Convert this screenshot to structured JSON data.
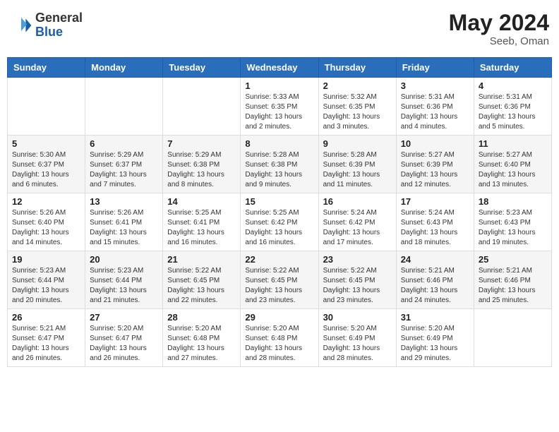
{
  "header": {
    "logo_line1": "General",
    "logo_line2": "Blue",
    "month_year": "May 2024",
    "location": "Seeb, Oman"
  },
  "days_of_week": [
    "Sunday",
    "Monday",
    "Tuesday",
    "Wednesday",
    "Thursday",
    "Friday",
    "Saturday"
  ],
  "weeks": [
    [
      {
        "day": "",
        "info": ""
      },
      {
        "day": "",
        "info": ""
      },
      {
        "day": "",
        "info": ""
      },
      {
        "day": "1",
        "info": "Sunrise: 5:33 AM\nSunset: 6:35 PM\nDaylight: 13 hours\nand 2 minutes."
      },
      {
        "day": "2",
        "info": "Sunrise: 5:32 AM\nSunset: 6:35 PM\nDaylight: 13 hours\nand 3 minutes."
      },
      {
        "day": "3",
        "info": "Sunrise: 5:31 AM\nSunset: 6:36 PM\nDaylight: 13 hours\nand 4 minutes."
      },
      {
        "day": "4",
        "info": "Sunrise: 5:31 AM\nSunset: 6:36 PM\nDaylight: 13 hours\nand 5 minutes."
      }
    ],
    [
      {
        "day": "5",
        "info": "Sunrise: 5:30 AM\nSunset: 6:37 PM\nDaylight: 13 hours\nand 6 minutes."
      },
      {
        "day": "6",
        "info": "Sunrise: 5:29 AM\nSunset: 6:37 PM\nDaylight: 13 hours\nand 7 minutes."
      },
      {
        "day": "7",
        "info": "Sunrise: 5:29 AM\nSunset: 6:38 PM\nDaylight: 13 hours\nand 8 minutes."
      },
      {
        "day": "8",
        "info": "Sunrise: 5:28 AM\nSunset: 6:38 PM\nDaylight: 13 hours\nand 9 minutes."
      },
      {
        "day": "9",
        "info": "Sunrise: 5:28 AM\nSunset: 6:39 PM\nDaylight: 13 hours\nand 11 minutes."
      },
      {
        "day": "10",
        "info": "Sunrise: 5:27 AM\nSunset: 6:39 PM\nDaylight: 13 hours\nand 12 minutes."
      },
      {
        "day": "11",
        "info": "Sunrise: 5:27 AM\nSunset: 6:40 PM\nDaylight: 13 hours\nand 13 minutes."
      }
    ],
    [
      {
        "day": "12",
        "info": "Sunrise: 5:26 AM\nSunset: 6:40 PM\nDaylight: 13 hours\nand 14 minutes."
      },
      {
        "day": "13",
        "info": "Sunrise: 5:26 AM\nSunset: 6:41 PM\nDaylight: 13 hours\nand 15 minutes."
      },
      {
        "day": "14",
        "info": "Sunrise: 5:25 AM\nSunset: 6:41 PM\nDaylight: 13 hours\nand 16 minutes."
      },
      {
        "day": "15",
        "info": "Sunrise: 5:25 AM\nSunset: 6:42 PM\nDaylight: 13 hours\nand 16 minutes."
      },
      {
        "day": "16",
        "info": "Sunrise: 5:24 AM\nSunset: 6:42 PM\nDaylight: 13 hours\nand 17 minutes."
      },
      {
        "day": "17",
        "info": "Sunrise: 5:24 AM\nSunset: 6:43 PM\nDaylight: 13 hours\nand 18 minutes."
      },
      {
        "day": "18",
        "info": "Sunrise: 5:23 AM\nSunset: 6:43 PM\nDaylight: 13 hours\nand 19 minutes."
      }
    ],
    [
      {
        "day": "19",
        "info": "Sunrise: 5:23 AM\nSunset: 6:44 PM\nDaylight: 13 hours\nand 20 minutes."
      },
      {
        "day": "20",
        "info": "Sunrise: 5:23 AM\nSunset: 6:44 PM\nDaylight: 13 hours\nand 21 minutes."
      },
      {
        "day": "21",
        "info": "Sunrise: 5:22 AM\nSunset: 6:45 PM\nDaylight: 13 hours\nand 22 minutes."
      },
      {
        "day": "22",
        "info": "Sunrise: 5:22 AM\nSunset: 6:45 PM\nDaylight: 13 hours\nand 23 minutes."
      },
      {
        "day": "23",
        "info": "Sunrise: 5:22 AM\nSunset: 6:45 PM\nDaylight: 13 hours\nand 23 minutes."
      },
      {
        "day": "24",
        "info": "Sunrise: 5:21 AM\nSunset: 6:46 PM\nDaylight: 13 hours\nand 24 minutes."
      },
      {
        "day": "25",
        "info": "Sunrise: 5:21 AM\nSunset: 6:46 PM\nDaylight: 13 hours\nand 25 minutes."
      }
    ],
    [
      {
        "day": "26",
        "info": "Sunrise: 5:21 AM\nSunset: 6:47 PM\nDaylight: 13 hours\nand 26 minutes."
      },
      {
        "day": "27",
        "info": "Sunrise: 5:20 AM\nSunset: 6:47 PM\nDaylight: 13 hours\nand 26 minutes."
      },
      {
        "day": "28",
        "info": "Sunrise: 5:20 AM\nSunset: 6:48 PM\nDaylight: 13 hours\nand 27 minutes."
      },
      {
        "day": "29",
        "info": "Sunrise: 5:20 AM\nSunset: 6:48 PM\nDaylight: 13 hours\nand 28 minutes."
      },
      {
        "day": "30",
        "info": "Sunrise: 5:20 AM\nSunset: 6:49 PM\nDaylight: 13 hours\nand 28 minutes."
      },
      {
        "day": "31",
        "info": "Sunrise: 5:20 AM\nSunset: 6:49 PM\nDaylight: 13 hours\nand 29 minutes."
      },
      {
        "day": "",
        "info": ""
      }
    ]
  ]
}
